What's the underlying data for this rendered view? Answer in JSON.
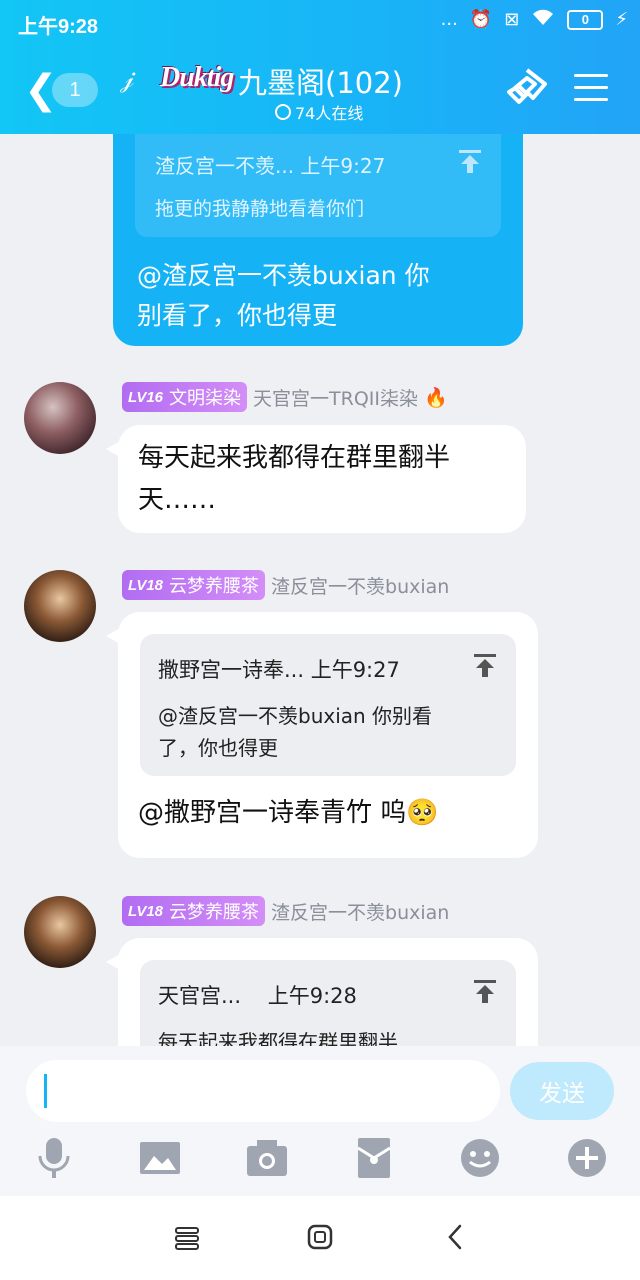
{
  "status_bar": {
    "time": "上午9:28",
    "dots": "...",
    "battery": "0"
  },
  "header": {
    "unread_count": "1",
    "brand_logo_text": "Duktig",
    "group_title": "九墨阁(102)",
    "online_text": "74人在线"
  },
  "messages": {
    "mine": {
      "quote_head": "渣反宫一不羡... 上午9:27",
      "quote_text": "拖更的我静静地看着你们",
      "text_line1": "@渣反宫一不羡buxian 你",
      "text_line2": "别看了，你也得更"
    },
    "m1": {
      "level": "LV16",
      "title": "文明柒染",
      "sender": "天官宫一TRQII柒染",
      "fire": "🔥",
      "text_line1": "每天起来我都得在群里翻半",
      "text_line2": "天……"
    },
    "m2": {
      "level": "LV18",
      "title": "云梦养腰茶",
      "sender": "渣反宫一不羡buxian",
      "quote_head": "撒野宫一诗奉... 上午9:27",
      "quote_line1": "@渣反宫一不羡buxian 你别看",
      "quote_line2": "了，你也得更",
      "text": "@撒野宫一诗奉青竹 呜🥺"
    },
    "m3": {
      "level": "LV18",
      "title": "云梦养腰茶",
      "sender": "渣反宫一不羡buxian",
      "quote_head": "天官宫...    上午9:28",
      "quote_text": "每天起来我都得在群里翻半"
    }
  },
  "input": {
    "send_label": "发送"
  },
  "colors": {
    "header": "#19b3f7",
    "my_bubble": "#15b2f6",
    "badge": "#c17ef5",
    "send_disabled": "#bfe9fc"
  }
}
